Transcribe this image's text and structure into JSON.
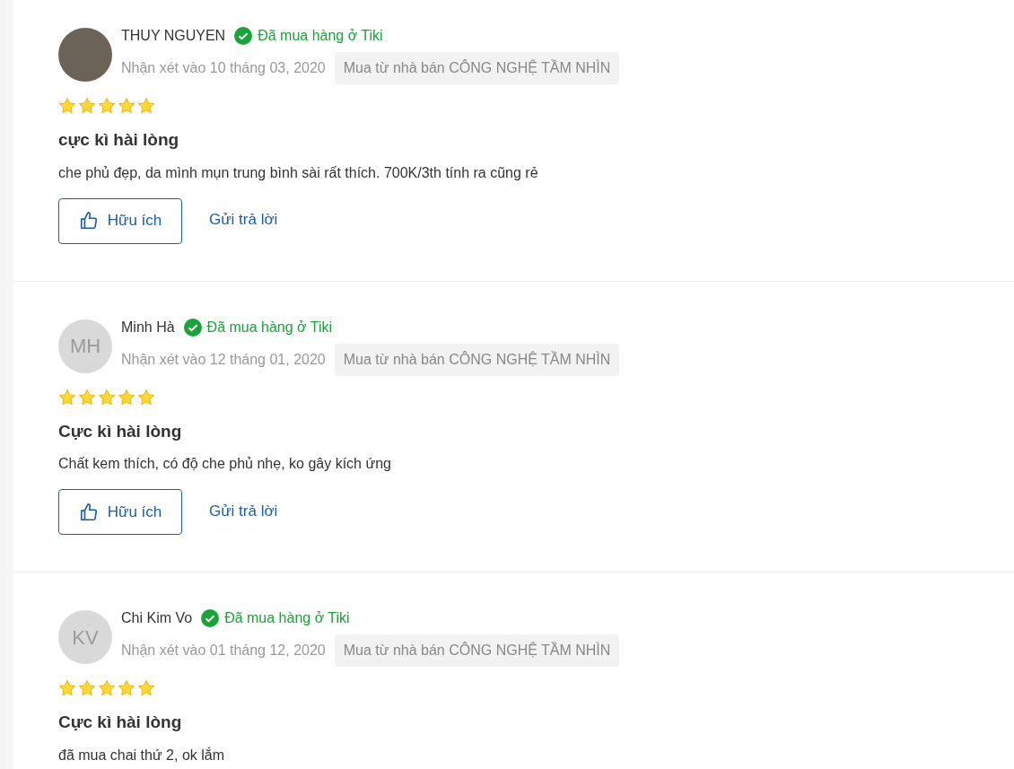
{
  "reviews": [
    {
      "name": "THUY NGUYEN",
      "avatar": {
        "kind": "photo"
      },
      "verified": "Đã mua hàng ở Tiki",
      "date": "Nhận xét vào 10 tháng 03, 2020",
      "seller": "Mua từ nhà bán CÔNG NGHỆ TẦM NHÌN",
      "stars": 5,
      "title": "cực kì hài lòng",
      "body": "che phủ đẹp, da mình mụn trung bình sài rất thích. 700K/3th tính ra cũng rẻ",
      "helpful": "Hữu ích",
      "reply": "Gửi trả lời"
    },
    {
      "name": "Minh Hà",
      "avatar": {
        "kind": "initials",
        "text": "MH"
      },
      "verified": "Đã mua hàng ở Tiki",
      "date": "Nhận xét vào 12 tháng 01, 2020",
      "seller": "Mua từ nhà bán CÔNG NGHỆ TẦM NHÌN",
      "stars": 5,
      "title": "Cực kì hài lòng",
      "body": "Chất kem thích, có độ che phủ nhẹ, ko gây kích ứng",
      "helpful": "Hữu ích",
      "reply": "Gửi trả lời"
    },
    {
      "name": "Chi Kim Vo",
      "avatar": {
        "kind": "initials",
        "text": "KV"
      },
      "verified": "Đã mua hàng ở Tiki",
      "date": "Nhận xét vào 01 tháng 12, 2020",
      "seller": "Mua từ nhà bán CÔNG NGHỆ TẦM NHÌN",
      "stars": 5,
      "title": "Cực kì hài lòng",
      "body": "đã mua chai thứ 2, ok lắm"
    }
  ]
}
